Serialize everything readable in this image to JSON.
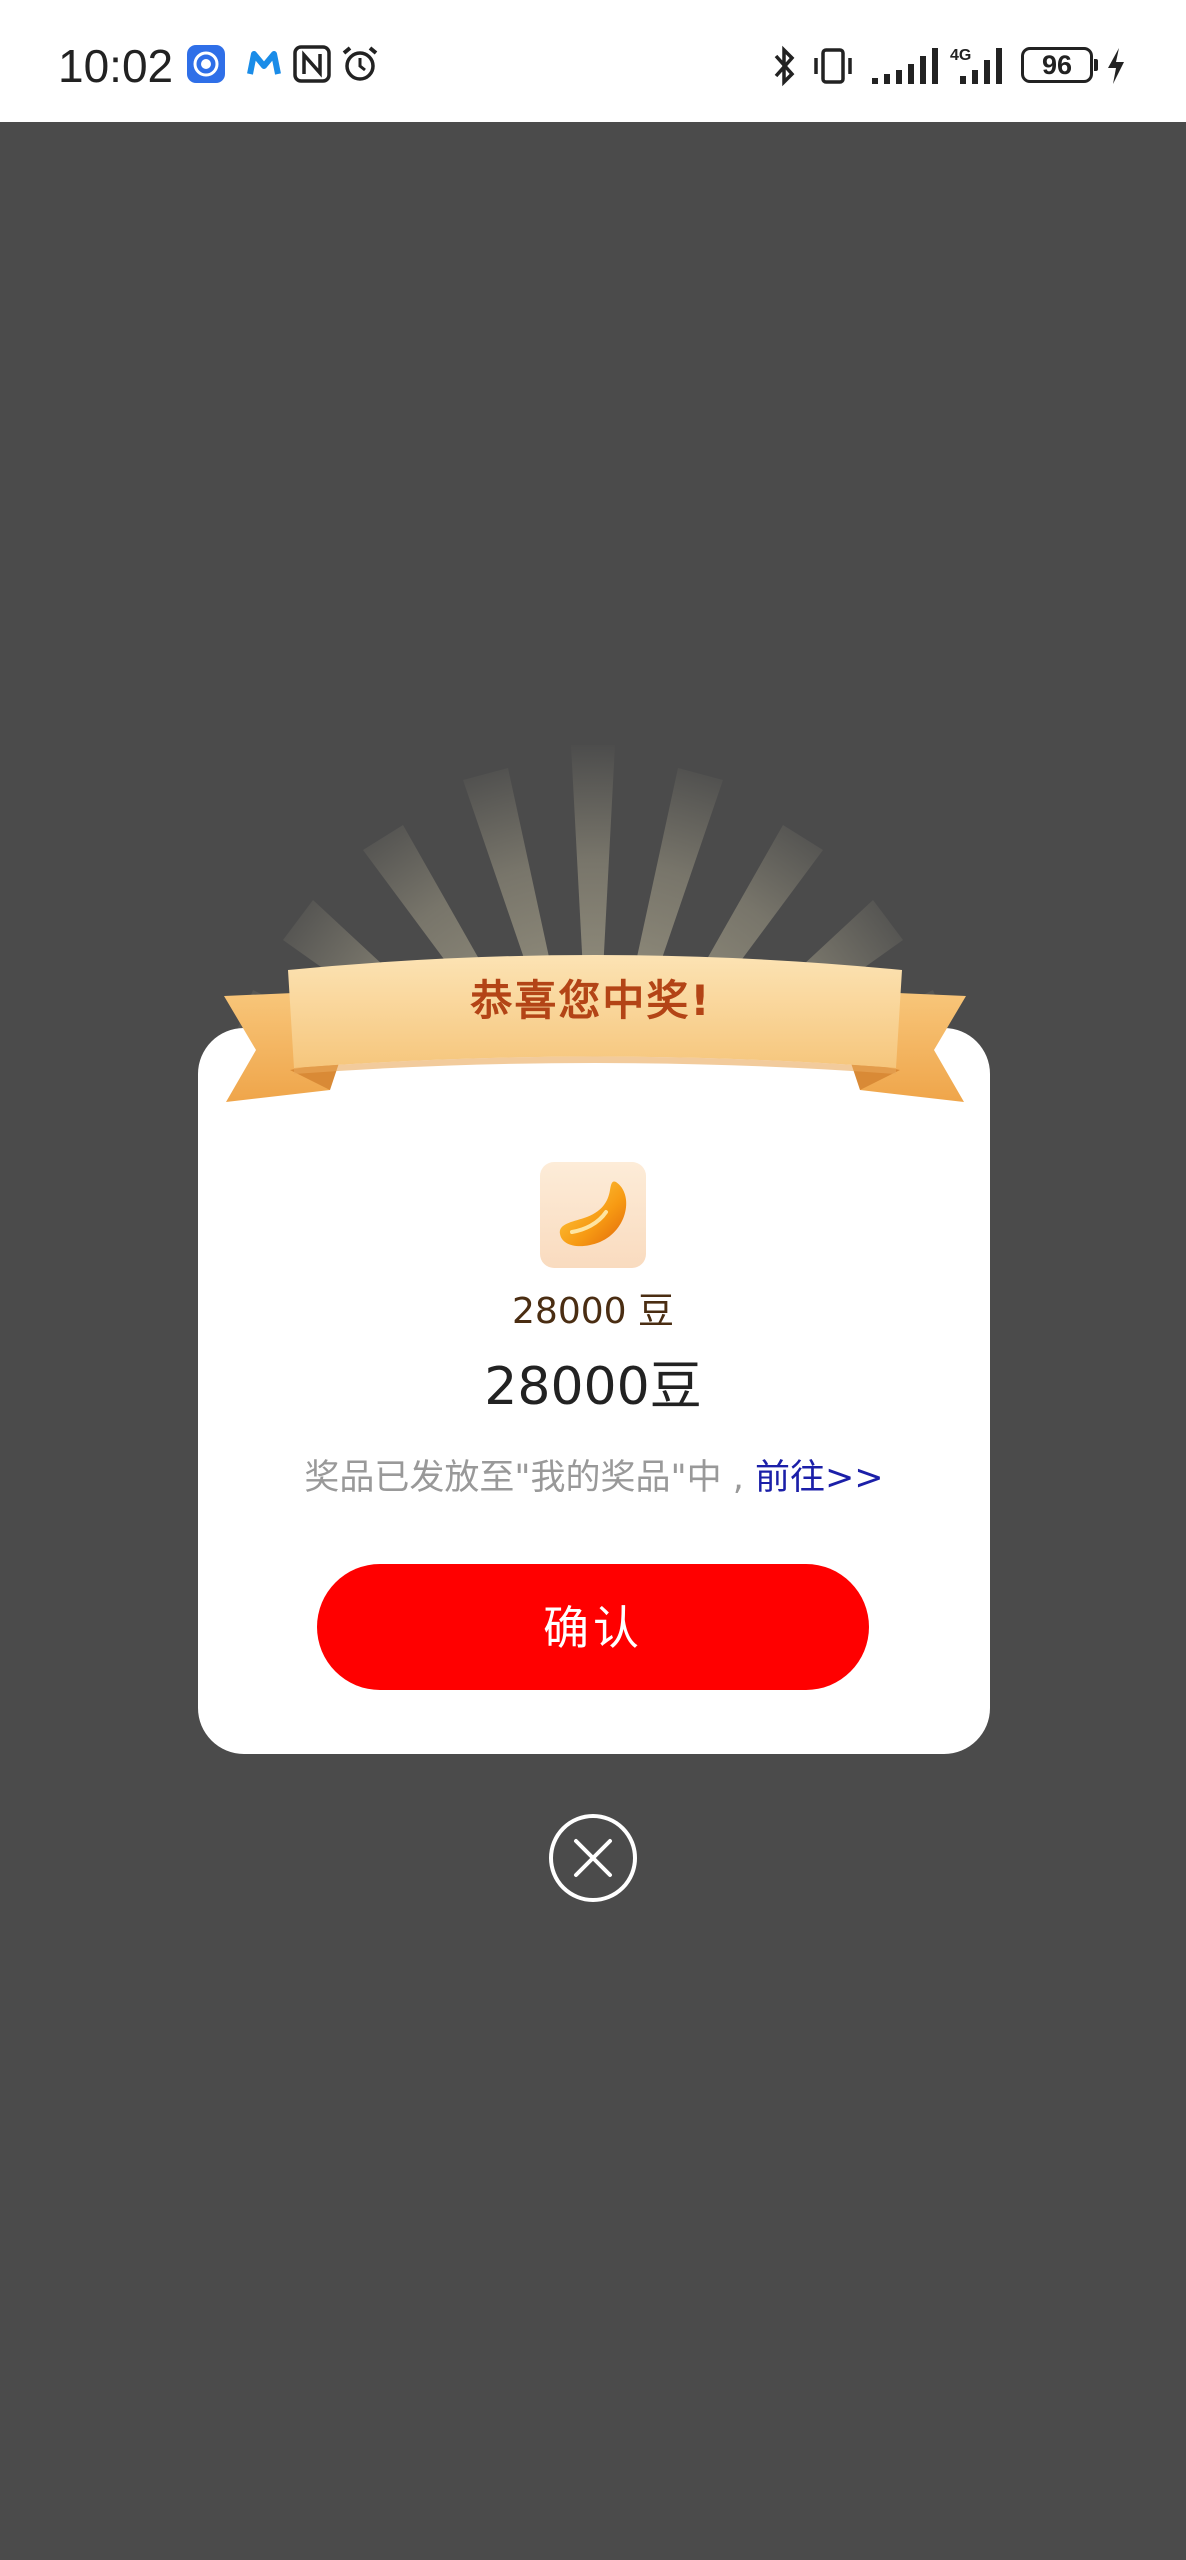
{
  "status_bar": {
    "time": "10:02",
    "battery_level": "96",
    "network_type": "4G",
    "icons_left": [
      "app-notification-icon",
      "m-app-icon",
      "nfc-icon",
      "alarm-icon"
    ],
    "icons_right": [
      "bluetooth-icon",
      "vibrate-icon",
      "signal-icon",
      "4g-signal-icon",
      "battery-icon",
      "charging-icon"
    ]
  },
  "dialog": {
    "title": "恭喜您中奖!",
    "prize_small_label": "28000 豆",
    "prize_big_label": "28000豆",
    "notice_text": "奖品已发放至\"我的奖品\"中 , ",
    "go_link": "前往>>",
    "confirm_label": "确认",
    "accent_color": "#ff0000",
    "ribbon_color": "#f7c77e",
    "title_color": "#b34416"
  },
  "close_button": {
    "icon": "close-circle-icon"
  }
}
